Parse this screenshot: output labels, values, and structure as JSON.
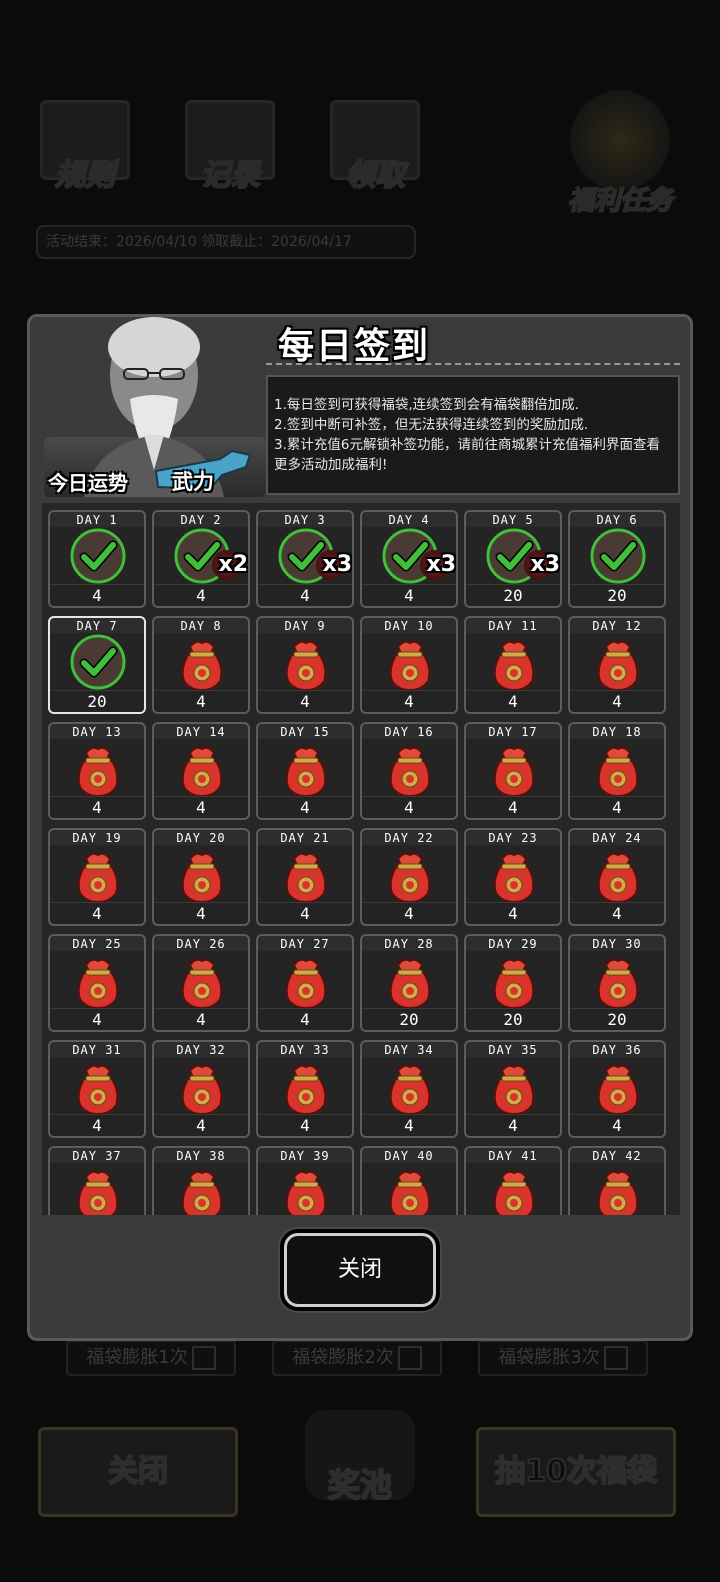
{
  "background": {
    "top_icons": [
      {
        "label": "规则",
        "icon": "rulebook-icon"
      },
      {
        "label": "记录",
        "icon": "record-pen-icon"
      },
      {
        "label": "领取",
        "icon": "printer-icon"
      }
    ],
    "welfare_task": {
      "label": "福利任务",
      "icon": "target-board-icon"
    },
    "dates": "活动结束：2026/04/10  领取截止：2026/04/17",
    "expand_options": [
      "福袋膨胀1次",
      "福袋膨胀2次",
      "福袋膨胀3次"
    ],
    "close_label": "关闭",
    "pool_label": "奖池",
    "draw_label": "抽10次福袋"
  },
  "modal": {
    "title": "每日签到",
    "fortune_label": "今日运势",
    "fortune_value": "武力",
    "rules": [
      "1.每日签到可获得福袋,连续签到会有福袋翻倍加成.",
      "2.签到中断可补签，但无法获得连续签到的奖励加成.",
      "3.累计充值6元解锁补签功能，请前往商城累计充值福利界面查看更多活动加成福利!"
    ],
    "days": [
      {
        "label": "DAY 1",
        "amount": "4",
        "signed": true,
        "multiplier": ""
      },
      {
        "label": "DAY 2",
        "amount": "4",
        "signed": true,
        "multiplier": "x2"
      },
      {
        "label": "DAY 3",
        "amount": "4",
        "signed": true,
        "multiplier": "x3"
      },
      {
        "label": "DAY 4",
        "amount": "4",
        "signed": true,
        "multiplier": "x3"
      },
      {
        "label": "DAY 5",
        "amount": "20",
        "signed": true,
        "multiplier": "x3"
      },
      {
        "label": "DAY 6",
        "amount": "20",
        "signed": true,
        "multiplier": ""
      },
      {
        "label": "DAY 7",
        "amount": "20",
        "signed": true,
        "multiplier": "",
        "current": true
      },
      {
        "label": "DAY 8",
        "amount": "4"
      },
      {
        "label": "DAY 9",
        "amount": "4"
      },
      {
        "label": "DAY 10",
        "amount": "4"
      },
      {
        "label": "DAY 11",
        "amount": "4"
      },
      {
        "label": "DAY 12",
        "amount": "4"
      },
      {
        "label": "DAY 13",
        "amount": "4"
      },
      {
        "label": "DAY 14",
        "amount": "4"
      },
      {
        "label": "DAY 15",
        "amount": "4"
      },
      {
        "label": "DAY 16",
        "amount": "4"
      },
      {
        "label": "DAY 17",
        "amount": "4"
      },
      {
        "label": "DAY 18",
        "amount": "4"
      },
      {
        "label": "DAY 19",
        "amount": "4"
      },
      {
        "label": "DAY 20",
        "amount": "4"
      },
      {
        "label": "DAY 21",
        "amount": "4"
      },
      {
        "label": "DAY 22",
        "amount": "4"
      },
      {
        "label": "DAY 23",
        "amount": "4"
      },
      {
        "label": "DAY 24",
        "amount": "4"
      },
      {
        "label": "DAY 25",
        "amount": "4"
      },
      {
        "label": "DAY 26",
        "amount": "4"
      },
      {
        "label": "DAY 27",
        "amount": "4"
      },
      {
        "label": "DAY 28",
        "amount": "20"
      },
      {
        "label": "DAY 29",
        "amount": "20"
      },
      {
        "label": "DAY 30",
        "amount": "20"
      },
      {
        "label": "DAY 31",
        "amount": "4"
      },
      {
        "label": "DAY 32",
        "amount": "4"
      },
      {
        "label": "DAY 33",
        "amount": "4"
      },
      {
        "label": "DAY 34",
        "amount": "4"
      },
      {
        "label": "DAY 35",
        "amount": "4"
      },
      {
        "label": "DAY 36",
        "amount": "4"
      },
      {
        "label": "DAY 37",
        "amount": ""
      },
      {
        "label": "DAY 38",
        "amount": ""
      },
      {
        "label": "DAY 39",
        "amount": ""
      },
      {
        "label": "DAY 40",
        "amount": ""
      },
      {
        "label": "DAY 41",
        "amount": ""
      },
      {
        "label": "DAY 42",
        "amount": ""
      }
    ],
    "close_button": "关闭"
  },
  "colors": {
    "check_green": "#3fbf3a",
    "bag_red": "#d9342b",
    "bag_gold": "#d4a94a",
    "panel_gray": "#3b3b3b"
  }
}
